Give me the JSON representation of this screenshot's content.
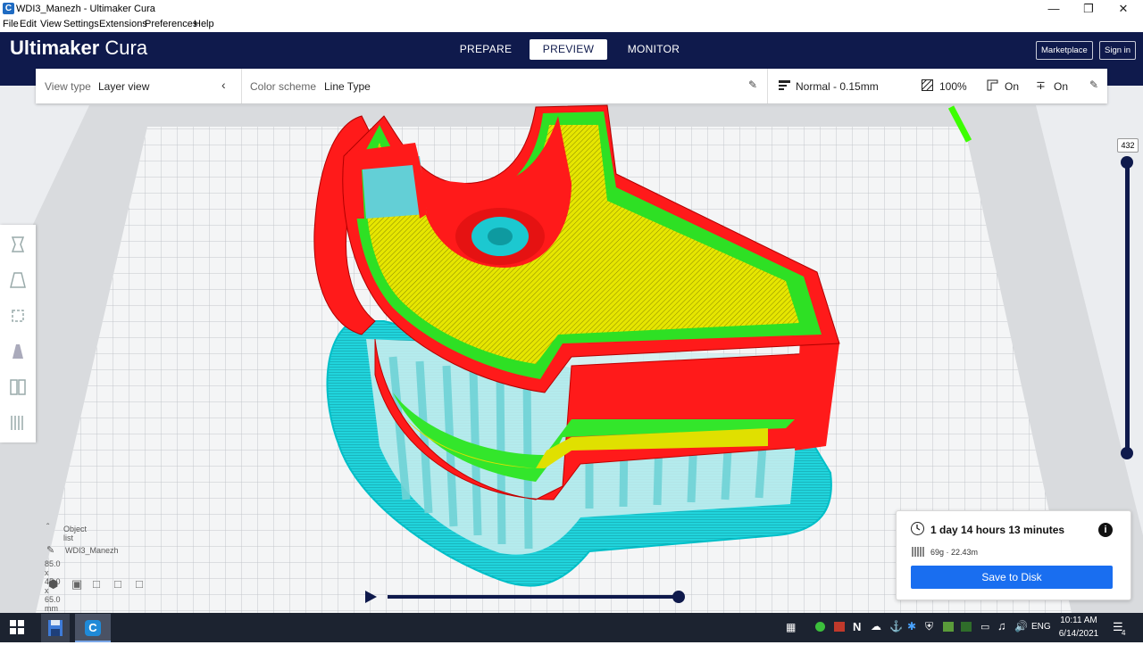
{
  "window": {
    "title": "WDI3_Manezh - Ultimaker Cura",
    "app_icon_letter": "C"
  },
  "menu": [
    "File",
    "Edit",
    "View",
    "Settings",
    "Extensions",
    "Preferences",
    "Help"
  ],
  "header": {
    "logo_bold": "Ultimaker",
    "logo_light": " Cura",
    "tabs": [
      "PREPARE",
      "PREVIEW",
      "MONITOR"
    ],
    "active_tab": "PREVIEW",
    "marketplace_label": "Marketplace",
    "signin_label": "Sign in"
  },
  "toolbar": {
    "view_type_label": "View type",
    "view_type_value": "Layer view",
    "color_scheme_label": "Color scheme",
    "color_scheme_value": "Line Type",
    "profile": "Normal - 0.15mm",
    "infill": "100%",
    "support": "On",
    "adhesion": "On"
  },
  "layer_slider": {
    "current_layer": "432"
  },
  "object_list": {
    "header": "Object list",
    "object_name": "WDI3_Manezh",
    "dimensions": "85.0 x 45.0 x 65.0 mm"
  },
  "print_info": {
    "time": "1 day 14 hours 13 minutes",
    "material": "69g · 22.43m",
    "save_label": "Save to Disk"
  },
  "taskbar": {
    "language": "ENG",
    "time": "10:11 AM",
    "date": "6/14/2021",
    "notification_count": "4"
  },
  "colors": {
    "header_bg": "#0f1a4c",
    "wall_outer": "#ff0000",
    "wall_inner": "#00e000",
    "infill": "#e6e600",
    "support": "#5fd2d2",
    "skirt": "#00d8e0",
    "accent_button": "#196ef0"
  },
  "icons": {
    "window_controls": [
      "minimize-icon",
      "maximize-icon",
      "close-icon"
    ],
    "tools": [
      "move-icon",
      "scale-icon",
      "rotate-icon",
      "mirror-icon",
      "per-model-settings-icon",
      "support-blocker-icon"
    ]
  }
}
